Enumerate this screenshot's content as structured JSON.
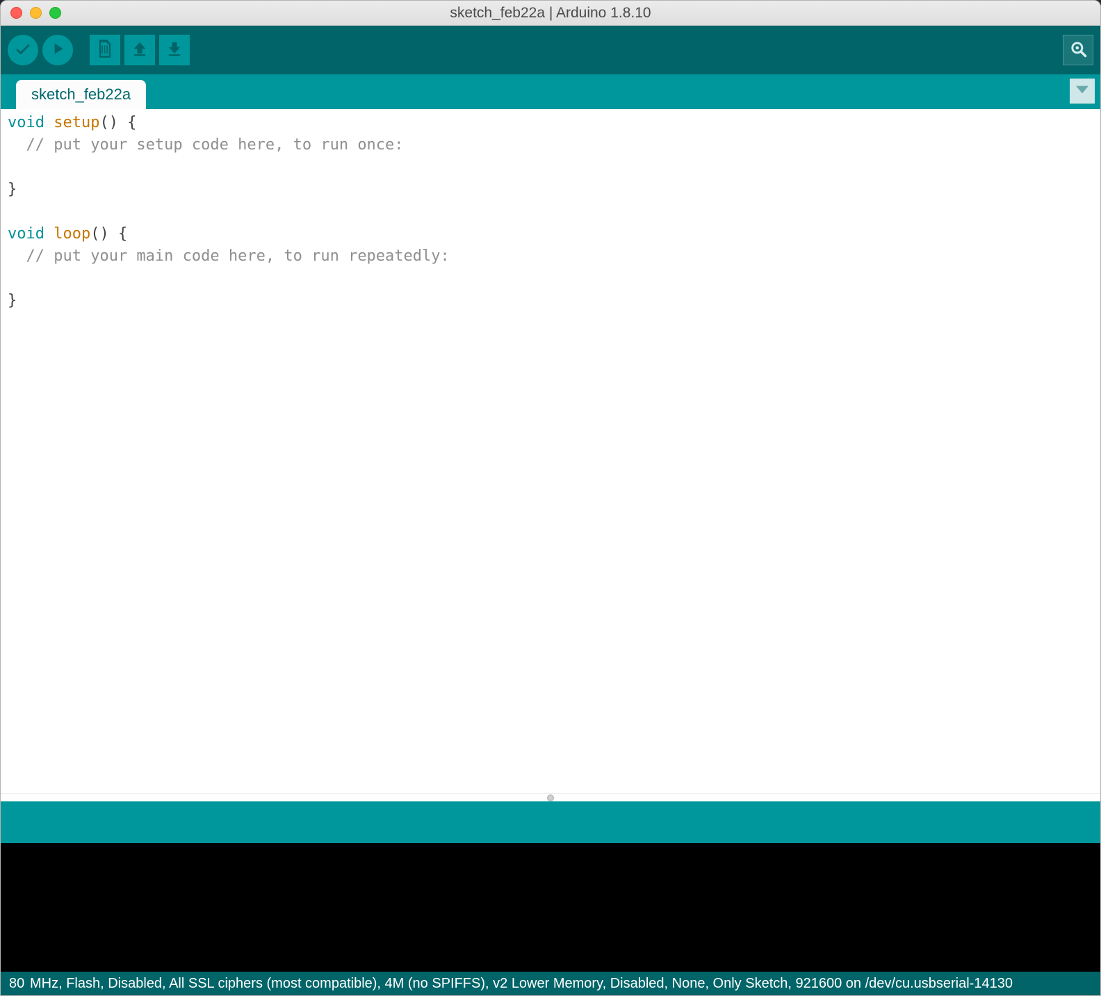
{
  "window": {
    "title": "sketch_feb22a | Arduino 1.8.10"
  },
  "toolbar": {
    "verify": "verify",
    "upload": "upload",
    "new": "new",
    "open": "open",
    "save": "save",
    "serial_monitor": "serial-monitor"
  },
  "tabs": {
    "active": "sketch_feb22a"
  },
  "code": {
    "lines": [
      {
        "parts": [
          {
            "t": "void ",
            "c": "kw"
          },
          {
            "t": "setup",
            "c": "fn"
          },
          {
            "t": "() {",
            "c": ""
          }
        ]
      },
      {
        "parts": [
          {
            "t": "  // put your setup code here, to run once:",
            "c": "cm"
          }
        ]
      },
      {
        "parts": [
          {
            "t": "",
            "c": ""
          }
        ]
      },
      {
        "parts": [
          {
            "t": "}",
            "c": ""
          }
        ]
      },
      {
        "parts": [
          {
            "t": "",
            "c": ""
          }
        ]
      },
      {
        "parts": [
          {
            "t": "void ",
            "c": "kw"
          },
          {
            "t": "loop",
            "c": "fn"
          },
          {
            "t": "() {",
            "c": ""
          }
        ]
      },
      {
        "parts": [
          {
            "t": "  // put your main code here, to run repeatedly:",
            "c": "cm"
          }
        ]
      },
      {
        "parts": [
          {
            "t": "",
            "c": ""
          }
        ]
      },
      {
        "parts": [
          {
            "t": "}",
            "c": ""
          }
        ]
      }
    ]
  },
  "status": {
    "line_indicator": "80",
    "config": " MHz, Flash, Disabled, All SSL ciphers (most compatible), 4M (no SPIFFS), v2 Lower Memory, Disabled, None, Only Sketch, 921600 on /dev/cu.usbserial-14130"
  }
}
